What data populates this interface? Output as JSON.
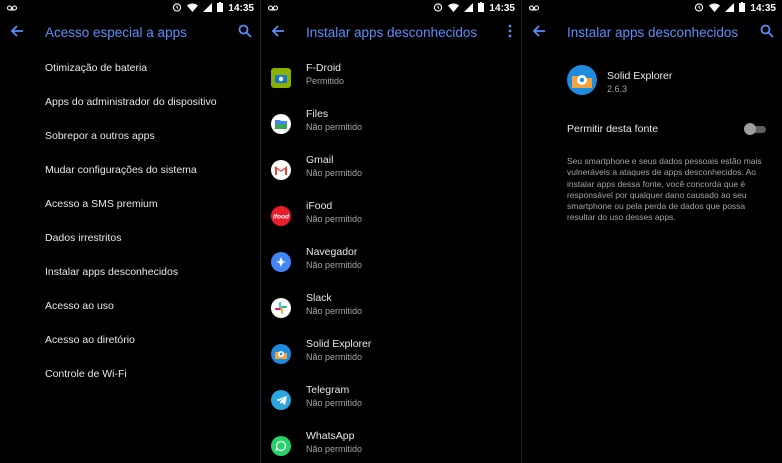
{
  "status": {
    "time": "14:35"
  },
  "screen1": {
    "title": "Acesso especial a apps",
    "items": [
      "Otimização de bateria",
      "Apps do administrador do dispositivo",
      "Sobrepor a outros apps",
      "Mudar configurações do sistema",
      "Acesso a SMS premium",
      "Dados irrestritos",
      "Instalar apps desconhecidos",
      "Acesso ao uso",
      "Acesso ao diretório",
      "Controle de Wi-Fi"
    ]
  },
  "screen2": {
    "title": "Instalar apps desconhecidos",
    "apps": [
      {
        "name": "F-Droid",
        "status": "Permitido",
        "icon": "fdroid-icon",
        "color": "#8ab000"
      },
      {
        "name": "Files",
        "status": "Não permitido",
        "icon": "files-icon",
        "color": "#ffffff"
      },
      {
        "name": "Gmail",
        "status": "Não permitido",
        "icon": "gmail-icon",
        "color": "#ffffff"
      },
      {
        "name": "iFood",
        "status": "Não permitido",
        "icon": "ifood-icon",
        "color": "#ea1d2c"
      },
      {
        "name": "Navegador",
        "status": "Não permitido",
        "icon": "browser-icon",
        "color": "#4285f4"
      },
      {
        "name": "Slack",
        "status": "Não permitido",
        "icon": "slack-icon",
        "color": "#ffffff"
      },
      {
        "name": "Solid Explorer",
        "status": "Não permitido",
        "icon": "solid-explorer-icon",
        "color": "#1c8be0"
      },
      {
        "name": "Telegram",
        "status": "Não permitido",
        "icon": "telegram-icon",
        "color": "#2ca5e0"
      },
      {
        "name": "WhatsApp",
        "status": "Não permitido",
        "icon": "whatsapp-icon",
        "color": "#25d366"
      }
    ]
  },
  "screen3": {
    "title": "Instalar apps desconhecidos",
    "app_name": "Solid Explorer",
    "version": "2.6.3",
    "toggle_label": "Permitir desta fonte",
    "toggle_on": false,
    "warning": "Seu smartphone e seus dados pessoais estão mais vulneráveis a ataques de apps desconhecidos. Ao instalar apps dessa fonte, você concorda que é responsável por qualquer dano causado ao seu smartphone ou pela perda de dados que possa resultar do uso desses apps."
  },
  "colors": {
    "accent": "#5b8df8",
    "background": "#000000",
    "text": "#e8e8e8",
    "secondary_text": "#a5a5a5"
  }
}
